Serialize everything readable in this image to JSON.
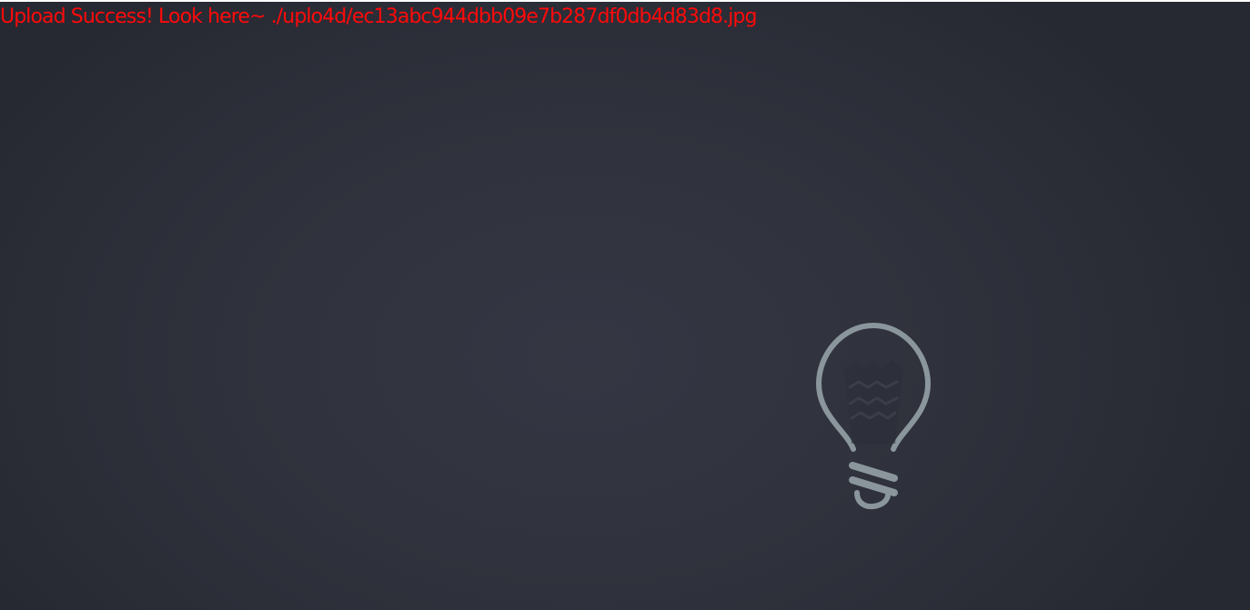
{
  "upload": {
    "message": "Upload Success! Look here~ ./uplo4d/ec13abc944dbb09e7b287df0db4d83d8.jpg",
    "message_color": "#ff0a0a"
  },
  "background": {
    "color": "#2f313c"
  },
  "light_switch": {
    "icon": "lightbulb-icon",
    "state": "off",
    "color": "#8a969c"
  }
}
